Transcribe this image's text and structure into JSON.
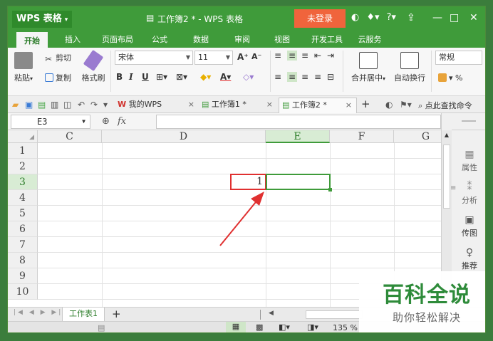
{
  "app": {
    "logo": "WPS 表格",
    "title": "工作簿2 * - WPS 表格",
    "login_label": "未登录"
  },
  "menu": {
    "tabs": [
      "开始",
      "插入",
      "页面布局",
      "公式",
      "数据",
      "审阅",
      "视图",
      "开发工具",
      "云服务"
    ]
  },
  "ribbon": {
    "paste": "粘贴",
    "cut": "剪切",
    "copy": "复制",
    "format_painter": "格式刷",
    "font_name": "宋体",
    "font_size": "11",
    "merge_center": "合并居中",
    "wrap_text": "自动换行",
    "number_format": "常规",
    "percent": "%"
  },
  "doc_tabs": {
    "items": [
      "我的WPS",
      "工作簿1 *",
      "工作簿2 *"
    ],
    "search": "点此查找命令"
  },
  "formula_bar": {
    "name_box": "E3",
    "fx": "fx"
  },
  "grid": {
    "columns": [
      "C",
      "D",
      "E",
      "F",
      "G"
    ],
    "rows": [
      "1",
      "2",
      "3",
      "4",
      "5",
      "6",
      "7",
      "8",
      "9",
      "10"
    ],
    "cell_d3": "1"
  },
  "right_panel": {
    "items": [
      "属性",
      "分析",
      "传图",
      "推荐"
    ]
  },
  "sheet_tabs": {
    "active": "工作表1",
    "add": "+"
  },
  "status_bar": {
    "zoom": "135 %"
  },
  "watermark": {
    "title": "百科全说",
    "subtitle": "助你轻松解决"
  },
  "colors": {
    "brand_green": "#3f9b3a",
    "login_orange": "#f0643c",
    "highlight_red": "#e03030"
  }
}
